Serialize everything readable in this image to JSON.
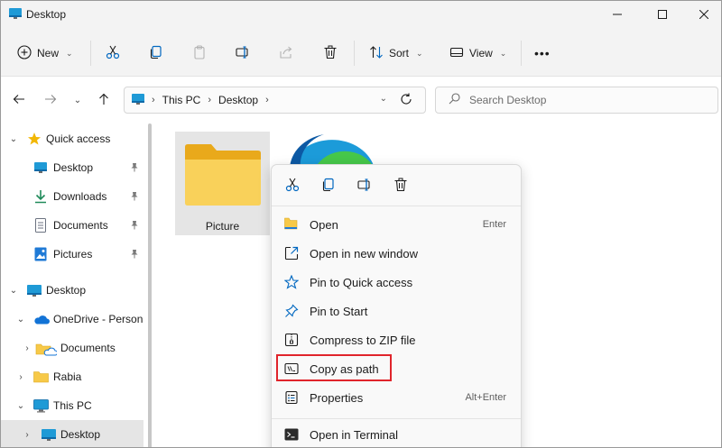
{
  "window": {
    "title": "Desktop"
  },
  "commandbar": {
    "new_label": "New",
    "sort_label": "Sort",
    "view_label": "View",
    "more": "•••"
  },
  "address": {
    "crumbs": [
      "This PC",
      "Desktop"
    ]
  },
  "search": {
    "placeholder": "Search Desktop"
  },
  "nav": {
    "items": [
      {
        "label": "Quick access"
      },
      {
        "label": "Desktop"
      },
      {
        "label": "Downloads"
      },
      {
        "label": "Documents"
      },
      {
        "label": "Pictures"
      },
      {
        "label": "Desktop"
      },
      {
        "label": "OneDrive - Persona"
      },
      {
        "label": "Documents"
      },
      {
        "label": "Rabia"
      },
      {
        "label": "This PC"
      },
      {
        "label": "Desktop"
      }
    ]
  },
  "content": {
    "folder_label": "Picture"
  },
  "context_menu": {
    "items": [
      {
        "label": "Open",
        "shortcut": "Enter"
      },
      {
        "label": "Open in new window",
        "shortcut": ""
      },
      {
        "label": "Pin to Quick access",
        "shortcut": ""
      },
      {
        "label": "Pin to Start",
        "shortcut": ""
      },
      {
        "label": "Compress to ZIP file",
        "shortcut": ""
      },
      {
        "label": "Copy as path",
        "shortcut": ""
      },
      {
        "label": "Properties",
        "shortcut": "Alt+Enter"
      },
      {
        "label": "Open in Terminal",
        "shortcut": ""
      }
    ]
  },
  "colors": {
    "accent": "#0067c0",
    "folder": "#f7c948",
    "highlight": "#e0242b",
    "selected": "#e5e5e5"
  }
}
